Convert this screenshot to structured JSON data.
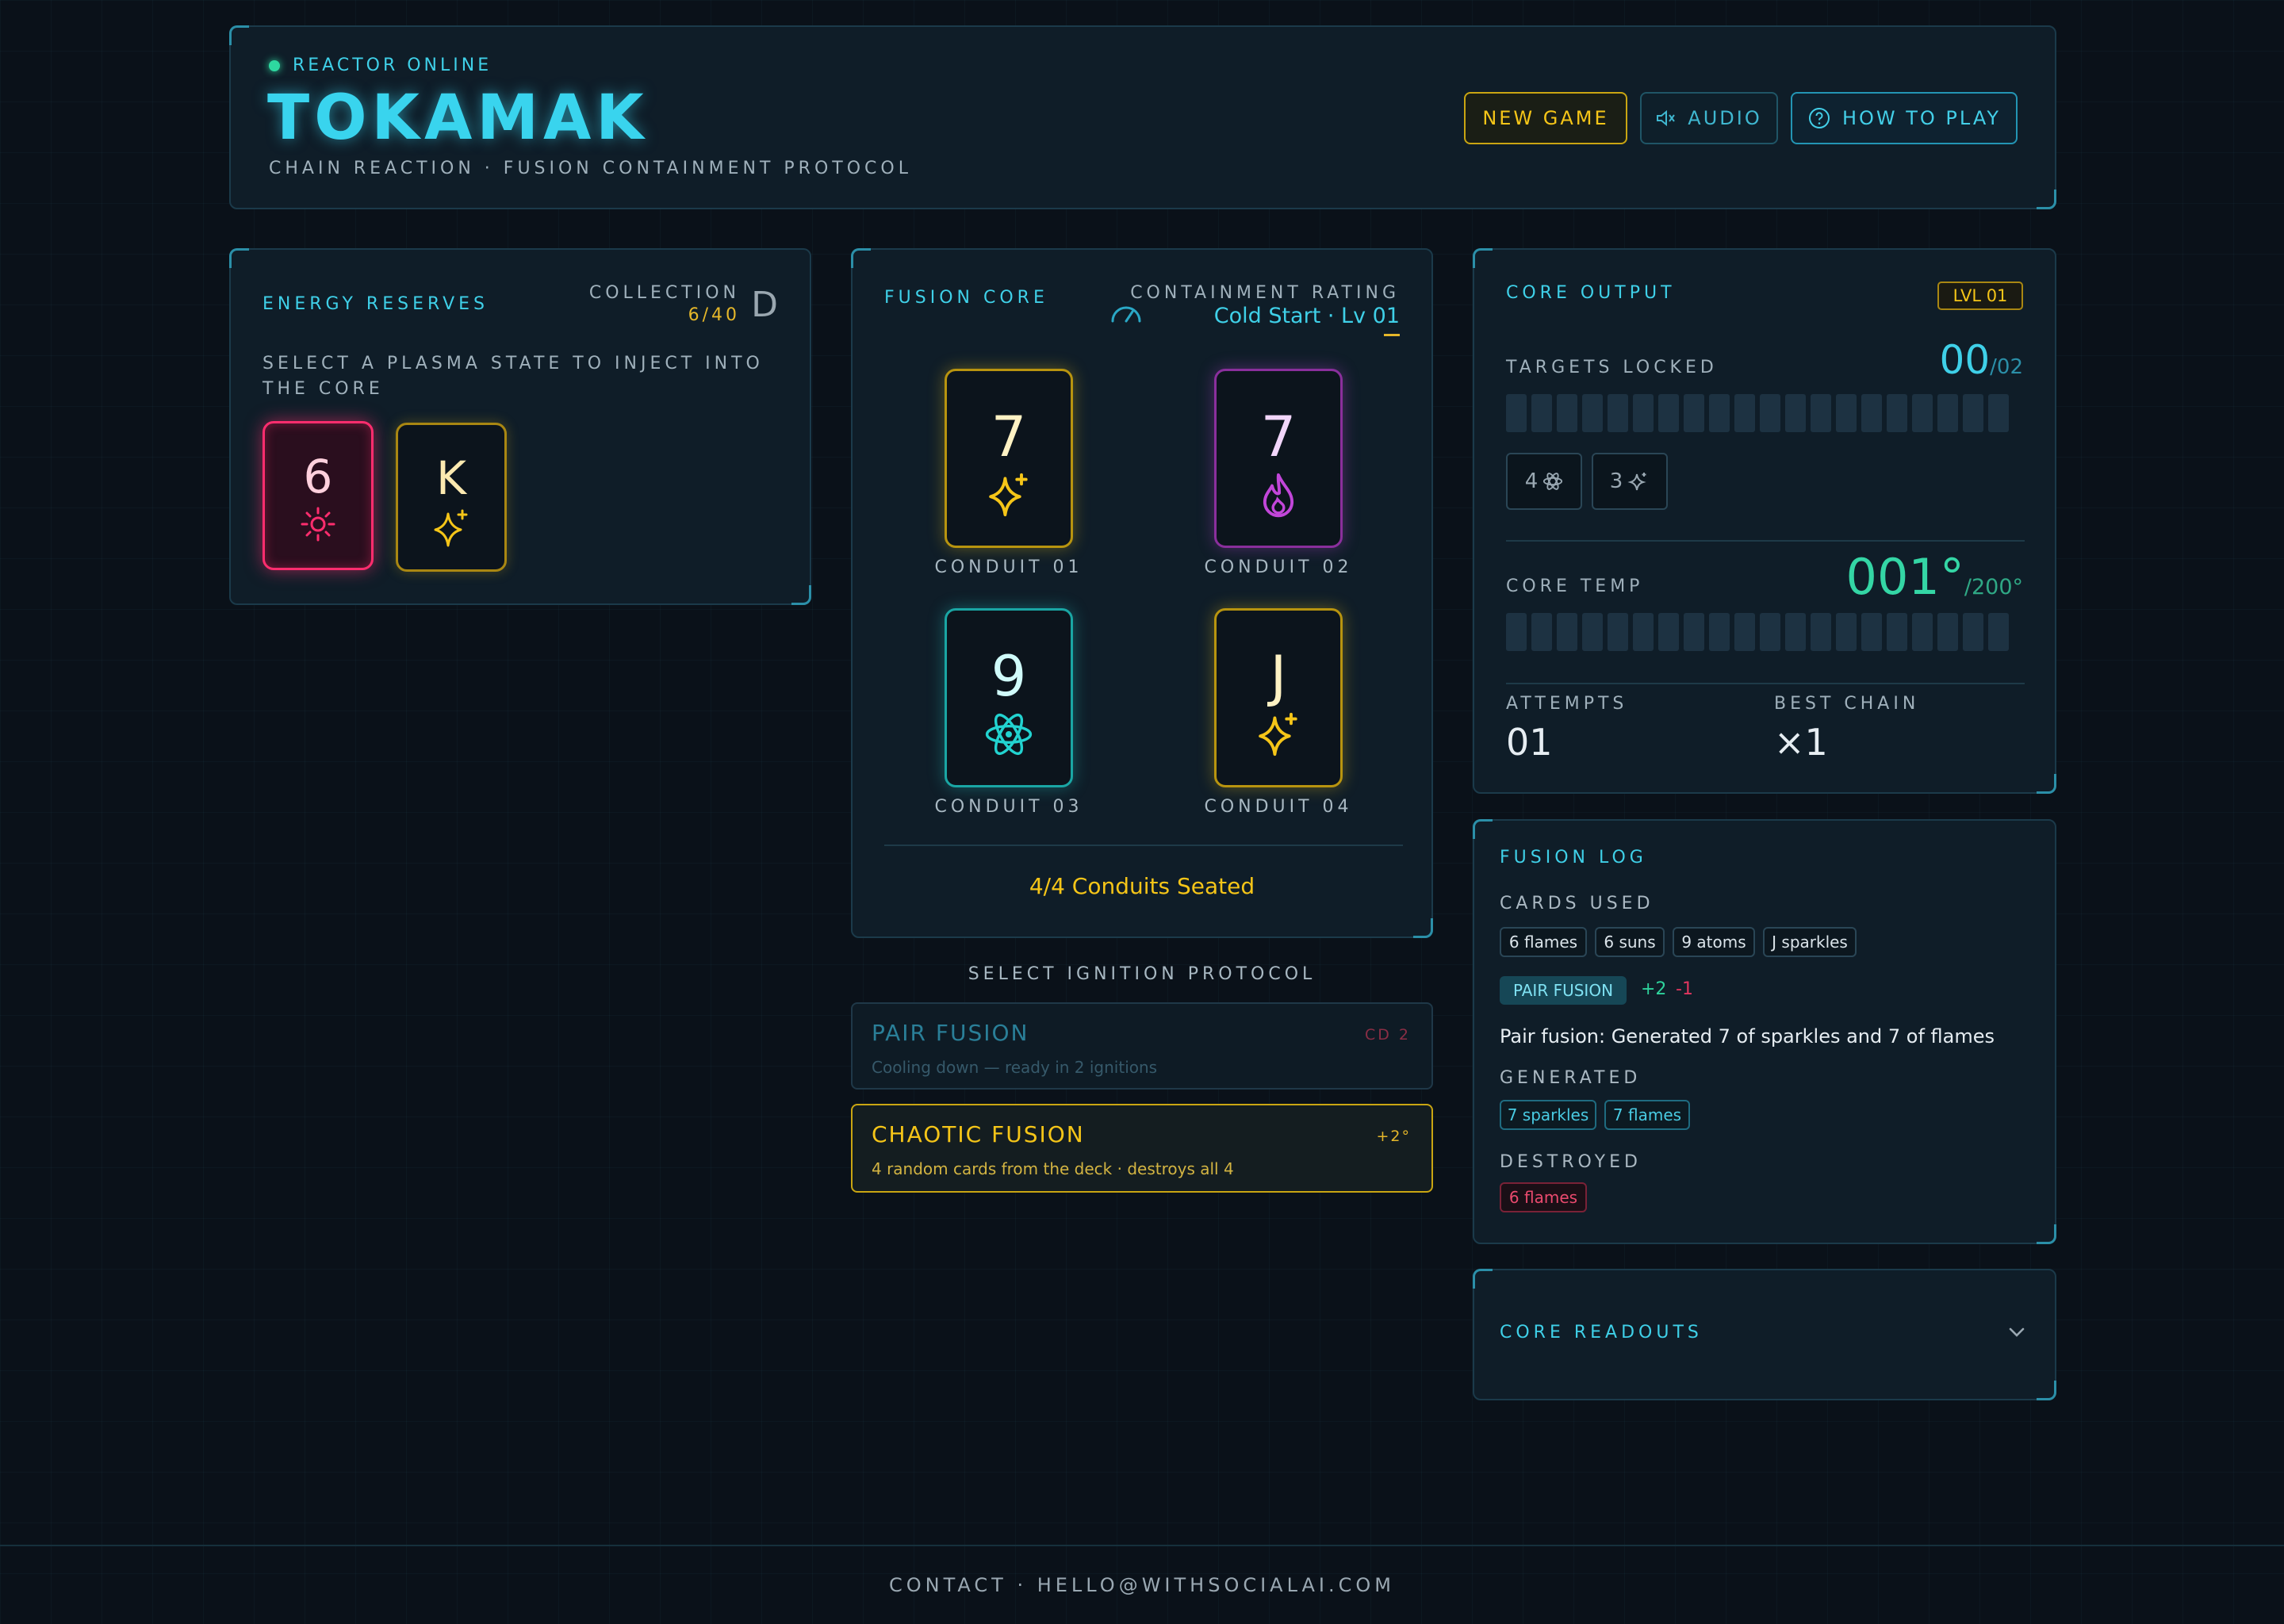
{
  "header": {
    "status": "REACTOR ONLINE",
    "title": "TOKAMAK",
    "subtitle": "CHAIN REACTION · FUSION CONTAINMENT PROTOCOL",
    "buttons": {
      "new_game": "NEW GAME",
      "audio": "AUDIO",
      "how_to_play": "HOW TO PLAY"
    }
  },
  "reserves": {
    "title": "ENERGY RESERVES",
    "collection_label": "COLLECTION",
    "collection_value": "6/40",
    "grade": "D",
    "instruction": "SELECT A PLASMA STATE TO INJECT INTO THE CORE",
    "cards": [
      {
        "rank": "6",
        "suit": "sun-icon",
        "color": "#ff2d6e"
      },
      {
        "rank": "K",
        "suit": "sparkle-icon",
        "color": "#f5c518"
      }
    ]
  },
  "core": {
    "title": "FUSION CORE",
    "rating_label": "CONTAINMENT RATING",
    "rating_value": "Cold Start · Lv 01",
    "conduits": [
      {
        "rank": "7",
        "suit": "sparkle-icon",
        "color": "#f5c518",
        "label": "CONDUIT 01"
      },
      {
        "rank": "7",
        "suit": "flame-icon",
        "color": "#c246d9",
        "label": "CONDUIT 02"
      },
      {
        "rank": "9",
        "suit": "atom-icon",
        "color": "#22d3d0",
        "label": "CONDUIT 03"
      },
      {
        "rank": "J",
        "suit": "sparkle-icon",
        "color": "#f5c518",
        "label": "CONDUIT 04"
      }
    ],
    "seated": "4/4 Conduits Seated"
  },
  "ignition": {
    "heading": "SELECT IGNITION PROTOCOL",
    "protocols": [
      {
        "name": "PAIR FUSION",
        "desc": "Cooling down — ready in 2 ignitions",
        "tag": "CD 2"
      },
      {
        "name": "CHAOTIC FUSION",
        "desc": "4 random cards from the deck · destroys all 4",
        "tag": "+2°"
      }
    ]
  },
  "output": {
    "title": "CORE OUTPUT",
    "level": "LVL 01",
    "targets_label": "TARGETS LOCKED",
    "targets_value": "00",
    "targets_total": "/02",
    "targets": [
      {
        "count": "4",
        "suit": "atom-icon"
      },
      {
        "count": "3",
        "suit": "sparkle-icon"
      }
    ],
    "temp_label": "CORE TEMP",
    "temp_value": "001°",
    "temp_max": "/200°",
    "attempts_label": "ATTEMPTS",
    "attempts_value": "01",
    "best_label": "BEST CHAIN",
    "best_value": "×1"
  },
  "log": {
    "title": "FUSION LOG",
    "cards_used_label": "CARDS USED",
    "cards_used": [
      "6 flames",
      "6 suns",
      "9 atoms",
      "J sparkles"
    ],
    "action": "PAIR FUSION",
    "plus": "+2",
    "minus": "-1",
    "message": "Pair fusion: Generated 7 of sparkles and 7 of flames",
    "generated_label": "GENERATED",
    "generated": [
      "7 sparkles",
      "7 flames"
    ],
    "destroyed_label": "DESTROYED",
    "destroyed": [
      "6 flames"
    ]
  },
  "readouts": {
    "title": "CORE READOUTS"
  },
  "footer": {
    "contact": "CONTACT · HELLO@WITHSOCIALAI.COM"
  }
}
